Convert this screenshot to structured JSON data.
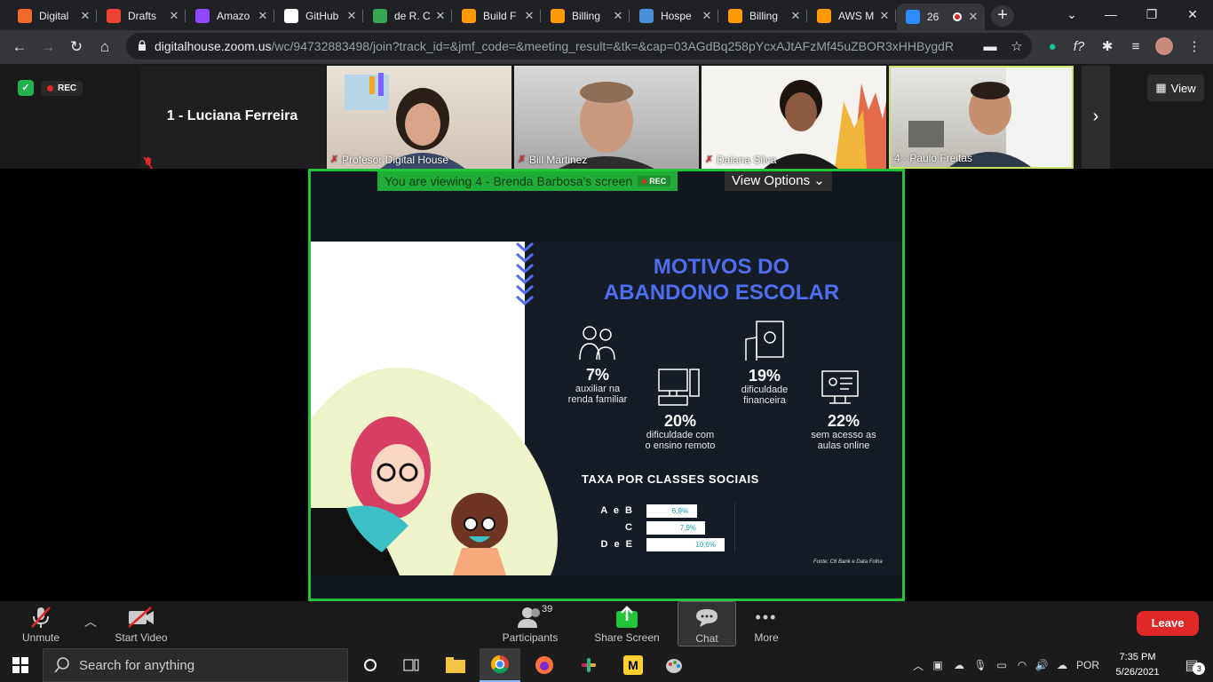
{
  "browser": {
    "tabs": [
      {
        "title": "Digital",
        "icon": "digital-house-icon",
        "color": "#f26a2e"
      },
      {
        "title": "Drafts",
        "icon": "gmail-icon",
        "color": "#ea4335"
      },
      {
        "title": "Amazo",
        "icon": "twitch-icon",
        "color": "#9146ff"
      },
      {
        "title": "GitHub",
        "icon": "github-icon",
        "color": "#ffffff"
      },
      {
        "title": "de R. C",
        "icon": "maps-icon",
        "color": "#34a853"
      },
      {
        "title": "Build F",
        "icon": "aws-icon",
        "color": "#f90"
      },
      {
        "title": "Billing",
        "icon": "aws-icon",
        "color": "#f90"
      },
      {
        "title": "Hospe",
        "icon": "hosting-icon",
        "color": "#4a90d9"
      },
      {
        "title": "Billing",
        "icon": "aws-icon",
        "color": "#f90"
      },
      {
        "title": "AWS M",
        "icon": "aws-icon",
        "color": "#f90"
      },
      {
        "title": "26",
        "icon": "zoom-icon",
        "color": "#2d8cff"
      }
    ],
    "url_host": "digitalhouse.zoom.us",
    "url_path": "/wc/94732883498/join?track_id=&jmf_code=&meeting_result=&tk=&cap=03AGdBq258pYcxAJtAFzMf45uZBOR3xHHBygdR-..."
  },
  "meeting": {
    "rec_label": "REC",
    "active_speaker": "1 - Luciana Ferreira",
    "participants": [
      {
        "name": "Profesor Digital House"
      },
      {
        "name": "Bill Martinez"
      },
      {
        "name": "Daiana Silva"
      },
      {
        "name": "4 - Paulo Freitas"
      }
    ],
    "view_label": "View",
    "viewing_banner": "You are viewing 4 - Brenda Barbosa's screen",
    "view_options_label": "View Options"
  },
  "slide": {
    "title_line1": "MOTIVOS DO",
    "title_line2": "ABANDONO ESCOLAR",
    "stats": [
      {
        "pct": "7%",
        "desc_line1": "auxiliar na",
        "desc_line2": "renda familiar"
      },
      {
        "pct": "19%",
        "desc_line1": "dificuldade",
        "desc_line2": "financeira"
      },
      {
        "pct": "20%",
        "desc_line1": "dificuldade com",
        "desc_line2": "o ensino remoto"
      },
      {
        "pct": "22%",
        "desc_line1": "sem acesso as",
        "desc_line2": "aulas online"
      }
    ],
    "taxa_title": "TAXA POR CLASSES SOCIAIS",
    "fonte": "Fonte: C6 Bank e Data Folha",
    "accent": "#4e6ef2"
  },
  "chart_data": {
    "type": "bar",
    "title": "TAXA POR CLASSES SOCIAIS",
    "categories": [
      "A e B",
      "C",
      "D e E"
    ],
    "values": [
      6.9,
      7.9,
      10.6
    ],
    "value_labels": [
      "6,9%",
      "7,9%",
      "10,6%"
    ],
    "orientation": "horizontal"
  },
  "controls": {
    "unmute": "Unmute",
    "start_video": "Start Video",
    "participants": "Participants",
    "participants_count": "39",
    "share_screen": "Share Screen",
    "chat": "Chat",
    "more": "More",
    "leave": "Leave"
  },
  "taskbar": {
    "search_placeholder": "Search for anything",
    "language": "POR",
    "time": "7:35 PM",
    "date": "5/26/2021",
    "notifications": "3"
  }
}
